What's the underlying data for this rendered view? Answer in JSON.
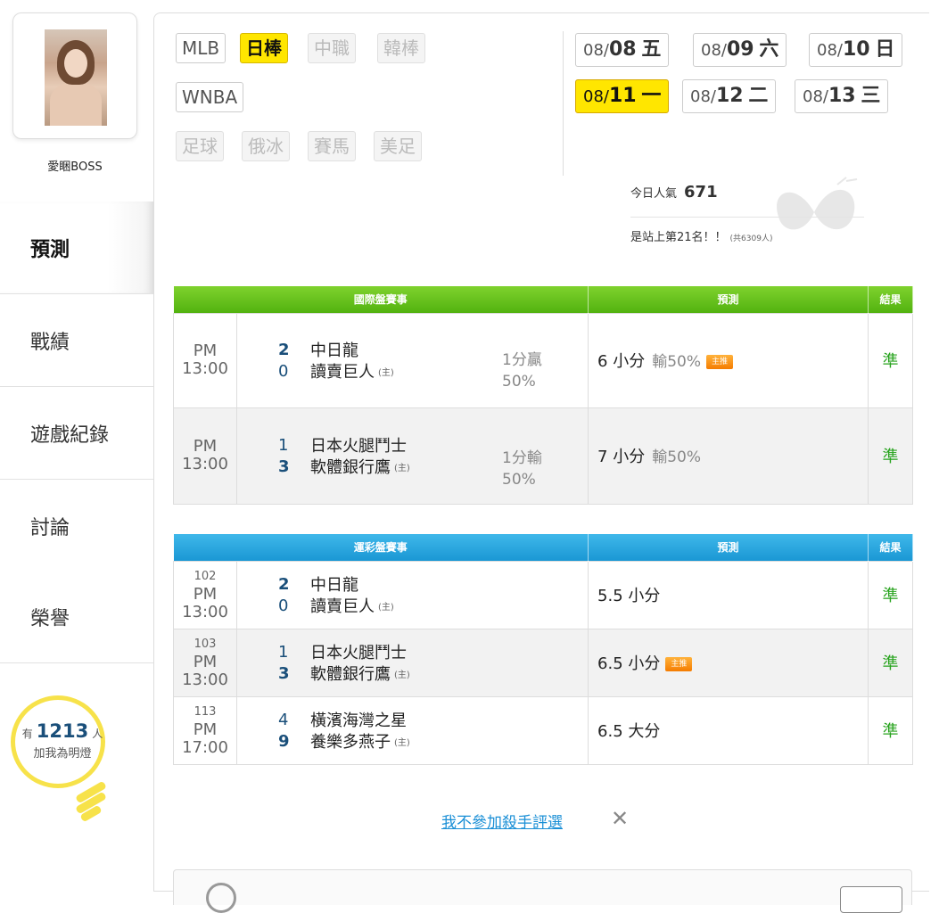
{
  "profile": {
    "name": "愛睏BOSS"
  },
  "nav": [
    "預測",
    "戰績",
    "遊戲紀錄",
    "討論",
    "榮譽"
  ],
  "fans": {
    "prefix": "有",
    "count": "1213",
    "suffix": "人",
    "line2": "加我為明燈"
  },
  "filters": {
    "row1": [
      {
        "label": "MLB",
        "state": "normal"
      },
      {
        "label": "日棒",
        "state": "selected"
      },
      {
        "label": "中職",
        "state": "disabled"
      },
      {
        "label": "韓棒",
        "state": "disabled"
      }
    ],
    "row2": [
      {
        "label": "WNBA",
        "state": "normal"
      }
    ],
    "row3": [
      {
        "label": "足球",
        "state": "disabled"
      },
      {
        "label": "俄冰",
        "state": "disabled"
      },
      {
        "label": "賽馬",
        "state": "disabled"
      },
      {
        "label": "美足",
        "state": "disabled"
      }
    ]
  },
  "dates": [
    {
      "month": "08/",
      "day": "08",
      "weekday": "五",
      "selected": false
    },
    {
      "month": "08/",
      "day": "09",
      "weekday": "六",
      "selected": false
    },
    {
      "month": "08/",
      "day": "10",
      "weekday": "日",
      "selected": false
    },
    {
      "month": "08/",
      "day": "11",
      "weekday": "一",
      "selected": true
    },
    {
      "month": "08/",
      "day": "12",
      "weekday": "二",
      "selected": false
    },
    {
      "month": "08/",
      "day": "13",
      "weekday": "三",
      "selected": false
    }
  ],
  "popularity": {
    "label": "今日人氣",
    "value": "671",
    "rank_text": "是站上第21名！！",
    "total": "(共6309人)"
  },
  "intl_table": {
    "headers": [
      "國際盤賽事",
      "預測",
      "結果"
    ],
    "rows": [
      {
        "time": "PM 13:00",
        "s1": "2",
        "s2": "0",
        "t1": "中日龍",
        "t2": "讀賣巨人",
        "host": "(主)",
        "line1": "1分贏",
        "line2": "50%",
        "pred": "6 小分",
        "lose": "輸50%",
        "badge": "主推",
        "result": "準"
      },
      {
        "time": "PM 13:00",
        "s1": "1",
        "s2": "3",
        "t1": "日本火腿鬥士",
        "t2": "軟體銀行鷹",
        "host": "(主)",
        "line1": "1分輸",
        "line2": "50%",
        "pred": "7 小分",
        "lose": "輸50%",
        "badge": "",
        "result": "準"
      }
    ]
  },
  "lottery_table": {
    "headers": [
      "運彩盤賽事",
      "預測",
      "結果"
    ],
    "rows": [
      {
        "num": "102",
        "time": "PM 13:00",
        "s1": "2",
        "s2": "0",
        "t1": "中日龍",
        "t2": "讀賣巨人",
        "host": "(主)",
        "pred": "5.5 小分",
        "badge": "",
        "result": "準"
      },
      {
        "num": "103",
        "time": "PM 13:00",
        "s1": "1",
        "s2": "3",
        "t1": "日本火腿鬥士",
        "t2": "軟體銀行鷹",
        "host": "(主)",
        "pred": "6.5 小分",
        "badge": "主推",
        "result": "準"
      },
      {
        "num": "113",
        "time": "PM 17:00",
        "s1": "4",
        "s2": "9",
        "t1": "橫濱海灣之星",
        "t2": "養樂多燕子",
        "host": "(主)",
        "pred": "6.5 大分",
        "badge": "",
        "result": "準"
      }
    ]
  },
  "optout": {
    "label": "我不參加殺手評選",
    "close": "✕"
  },
  "colors": {
    "accent_yellow": "#ffe600",
    "green_header": "#52b20f",
    "blue_header": "#1a97d4",
    "result_green": "#27a31d",
    "score_blue": "#1a4f7a"
  }
}
